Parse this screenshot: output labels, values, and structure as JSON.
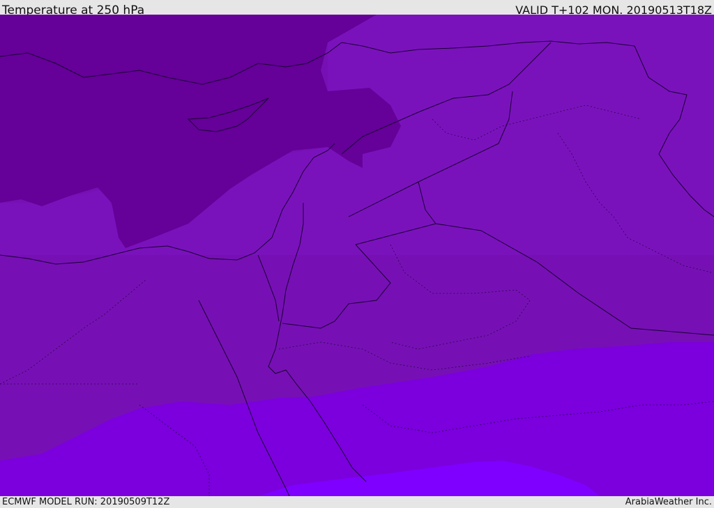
{
  "header": {
    "title": "Temperature at 250 hPa",
    "valid": "VALID T+102 MON. 20190513T18Z"
  },
  "footer": {
    "model_run": "ECMWF MODEL RUN: 20190509T12Z",
    "credit": "ArabiaWeather Inc."
  },
  "map": {
    "colors": {
      "band_coldest": "#660099",
      "band_cold": "#770fb0",
      "band_mid": "#7a10c0",
      "band_warm": "#7b00dd",
      "band_warmest": "#7f00ff",
      "coastline": "#1a0033"
    }
  }
}
